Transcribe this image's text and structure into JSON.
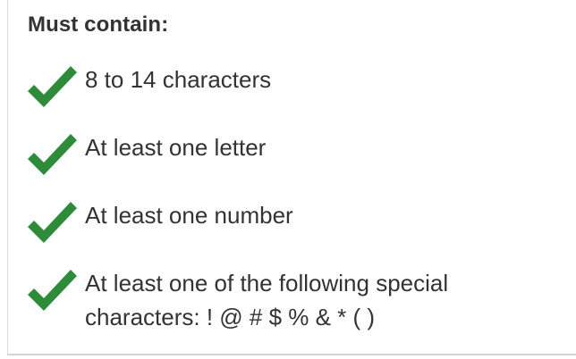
{
  "panel": {
    "heading": "Must contain:",
    "check_color": "#2e8b3a",
    "requirements": [
      {
        "icon": "checkmark-icon",
        "text": "8 to 14 characters"
      },
      {
        "icon": "checkmark-icon",
        "text": "At least one letter"
      },
      {
        "icon": "checkmark-icon",
        "text": "At least one number"
      },
      {
        "icon": "checkmark-icon",
        "text": "At least one of the following special characters: ! @ # $ % & * ( )"
      }
    ]
  }
}
